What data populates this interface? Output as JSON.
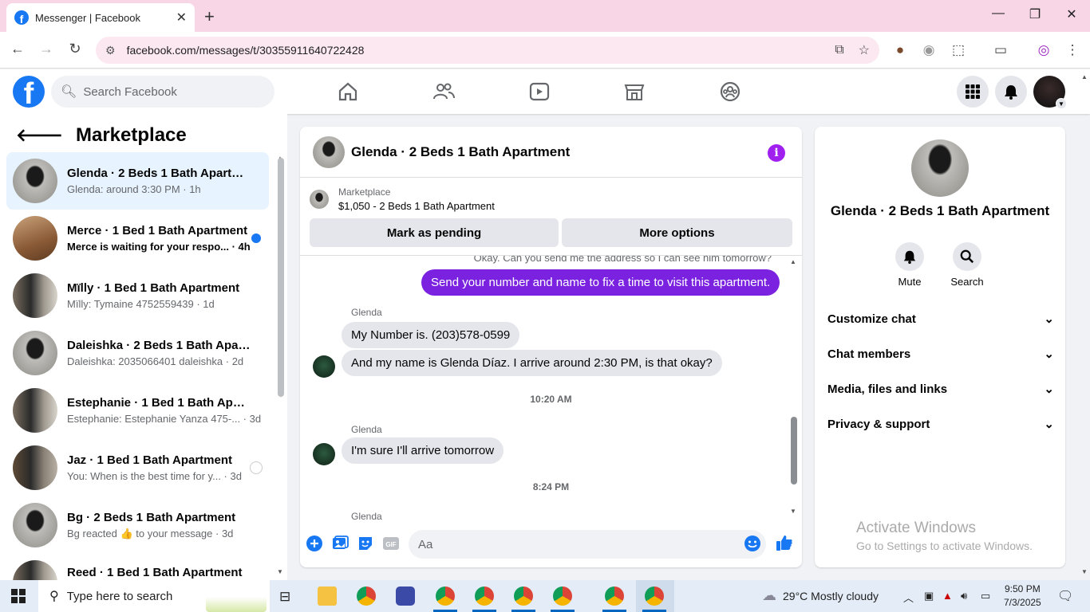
{
  "browser": {
    "tab_title": "Messenger | Facebook",
    "new_tab": "+",
    "url": "facebook.com/messages/t/30355911640722428"
  },
  "fb": {
    "search_placeholder": "Search Facebook"
  },
  "left": {
    "title": "Marketplace",
    "conversations": [
      {
        "name": "Glenda · 2 Beds 1 Bath Apartment",
        "preview": "Glenda: around 3:30 PM · 1h",
        "thumb": "black-box"
      },
      {
        "name": "Merce · 1 Bed 1 Bath Apartment",
        "preview": "Merce is waiting for your respo... · 4h",
        "thumb": "brown-room"
      },
      {
        "name": "Mïlly · 1 Bed 1 Bath Apartment",
        "preview": "Mïlly: Tymaine 4752559439 · 1d",
        "thumb": "kitchen"
      },
      {
        "name": "Daleishka · 2 Beds 1 Bath Apart...",
        "preview": "Daleishka: 2035066401 daleishka · 2d",
        "thumb": "black-box"
      },
      {
        "name": "Estephanie · 1 Bed 1 Bath Apart...",
        "preview": "Estephanie: Estephanie Yanza 475-... · 3d",
        "thumb": "kitchen"
      },
      {
        "name": "Jaz · 1 Bed 1 Bath Apartment",
        "preview": "You: When is the best time for y... · 3d",
        "thumb": "kitchen"
      },
      {
        "name": "Bg · 2 Beds 1 Bath Apartment",
        "preview": "Bg reacted 👍 to your message · 3d",
        "thumb": "black-box"
      },
      {
        "name": "Reed · 1 Bed 1 Bath Apartment",
        "preview": "",
        "thumb": "kitchen"
      }
    ]
  },
  "chat": {
    "header_name": "Glenda · 2 Beds 1 Bath Apartment",
    "marketplace_label": "Marketplace",
    "listing": "$1,050 - 2 Beds 1 Bath Apartment",
    "mark_pending": "Mark as pending",
    "more_options": "More options",
    "partial_top": "Okay. Can you send me the address so I can see him tomorrow?",
    "out_msg": "Send your number and name to fix a time to visit this apartment.",
    "sender": "Glenda",
    "msg1": "My Number is. (203)578-0599",
    "msg2": "And my name is Glenda  Díaz. I arrive around 2:30 PM, is that okay?",
    "time1": "10:20 AM",
    "msg3": "I'm sure I'll arrive tomorrow",
    "time2": "8:24 PM",
    "composer_placeholder": "Aa"
  },
  "right": {
    "name": "Glenda · 2 Beds 1 Bath Apartment",
    "mute": "Mute",
    "search": "Search",
    "sections": [
      "Customize chat",
      "Chat members",
      "Media, files and links",
      "Privacy & support"
    ],
    "activate_title": "Activate Windows",
    "activate_sub": "Go to Settings to activate Windows."
  },
  "taskbar": {
    "search": "Type here to search",
    "weather": "29°C  Mostly cloudy",
    "time": "9:50 PM",
    "date": "7/3/2025"
  },
  "colors": {
    "fb_blue": "#1877f2",
    "messenger_purple": "#7a22e0",
    "tab_pink": "#f9d6e6"
  }
}
